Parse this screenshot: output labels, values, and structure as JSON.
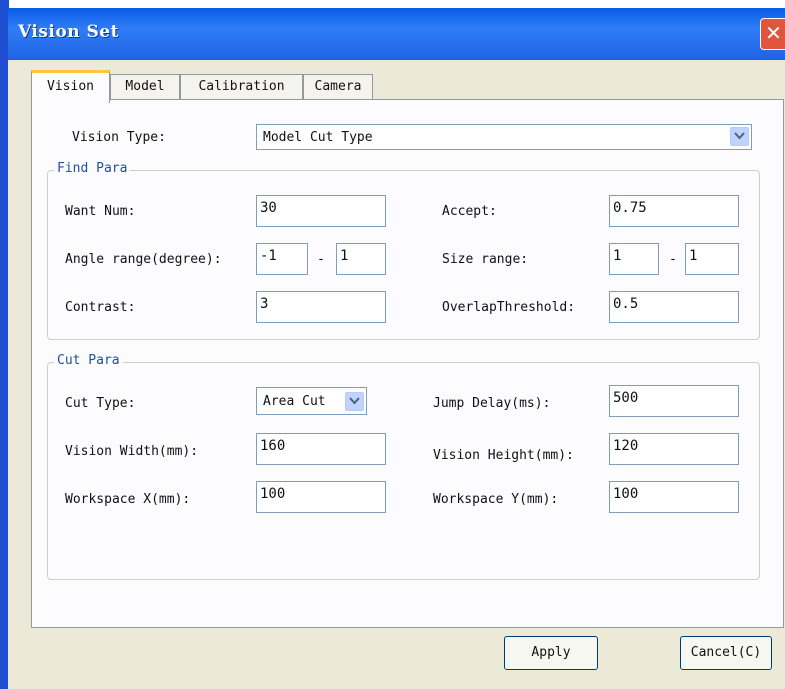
{
  "window": {
    "title": "Vision Set",
    "close_glyph": "✕"
  },
  "tabs": [
    "Vision",
    "Model",
    "Calibration",
    "Camera"
  ],
  "vision_type": {
    "label": "Vision Type:",
    "value": "Model Cut Type"
  },
  "find_para": {
    "legend": "Find Para",
    "want_num": {
      "label": "Want Num:",
      "value": "30"
    },
    "accept": {
      "label": "Accept:",
      "value": "0.75"
    },
    "angle_range": {
      "label": "Angle range(degree):",
      "min": "-1",
      "dash": "-",
      "max": "1"
    },
    "size_range": {
      "label": "Size range:",
      "min": "1",
      "dash": "-",
      "max": "1"
    },
    "contrast": {
      "label": "Contrast:",
      "value": "3"
    },
    "overlap": {
      "label": "OverlapThreshold:",
      "value": "0.5"
    }
  },
  "cut_para": {
    "legend": "Cut Para",
    "cut_type": {
      "label": "Cut Type:",
      "value": "Area Cut"
    },
    "jump_delay": {
      "label": "Jump Delay(ms):",
      "value": "500"
    },
    "vision_width": {
      "label": "Vision Width(mm):",
      "value": "160"
    },
    "vision_height": {
      "label": "Vision Height(mm):",
      "value": "120"
    },
    "workspace_x": {
      "label": "Workspace X(mm):",
      "value": "100"
    },
    "workspace_y": {
      "label": "Workspace Y(mm):",
      "value": "100"
    }
  },
  "buttons": {
    "apply": "Apply",
    "cancel": "Cancel(C)"
  },
  "colors": {
    "titlebar": "#1f63e4",
    "close": "#e0553e",
    "active_tab_accent": "#ffc83c",
    "group_legend": "#1f4fa0"
  }
}
